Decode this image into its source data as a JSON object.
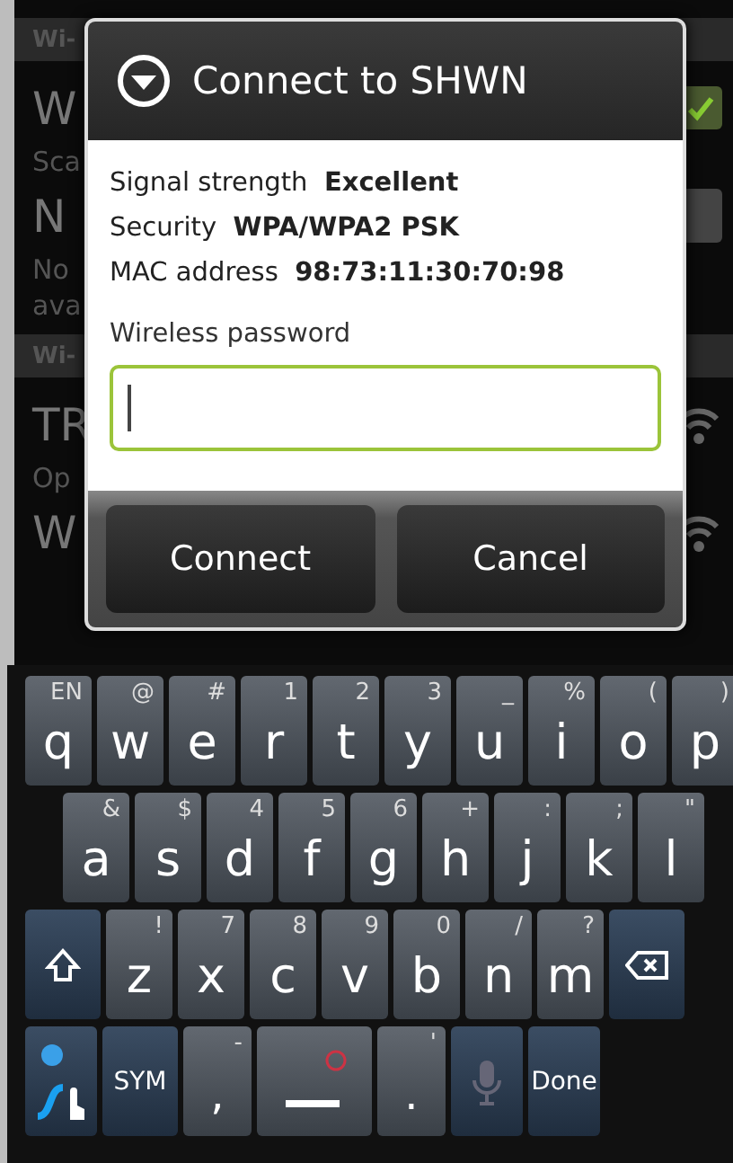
{
  "background": {
    "rows": [
      {
        "kind": "header",
        "text": "Wi-"
      },
      {
        "kind": "title",
        "text": "W",
        "checkbox": {
          "checked": true
        }
      },
      {
        "kind": "subtitle",
        "text": "Sca"
      },
      {
        "kind": "title",
        "text": "N",
        "toggle": true
      },
      {
        "kind": "subtitle",
        "text": "No"
      },
      {
        "kind": "subtitle",
        "text": "ava"
      },
      {
        "kind": "header",
        "text": "Wi-"
      },
      {
        "kind": "title",
        "text": "TR",
        "wifi": true
      },
      {
        "kind": "subtitle",
        "text": "Op"
      },
      {
        "kind": "title",
        "text": "W",
        "wifi": true
      }
    ]
  },
  "dialog": {
    "title": "Connect to SHWN",
    "details": [
      {
        "label": "Signal strength",
        "value": "Excellent"
      },
      {
        "label": "Security",
        "value": "WPA/WPA2 PSK"
      },
      {
        "label": "MAC address",
        "value": "98:73:11:30:70:98"
      }
    ],
    "password": {
      "label": "Wireless password",
      "focused": true
    },
    "buttons": [
      "Connect",
      "Cancel"
    ]
  },
  "keyboard": {
    "letter_rows": [
      [
        {
          "kind": "char",
          "hint": "EN",
          "main": "q"
        },
        {
          "kind": "char",
          "hint": "@",
          "main": "w"
        },
        {
          "kind": "char",
          "hint": "#",
          "main": "e"
        },
        {
          "kind": "char",
          "hint": "1",
          "main": "r"
        },
        {
          "kind": "char",
          "hint": "2",
          "main": "t"
        },
        {
          "kind": "char",
          "hint": "3",
          "main": "y"
        },
        {
          "kind": "char",
          "hint": "_",
          "main": "u"
        },
        {
          "kind": "char",
          "hint": "%",
          "main": "i"
        },
        {
          "kind": "char",
          "hint": "(",
          "main": "o"
        },
        {
          "kind": "char",
          "hint": ")",
          "main": "p"
        }
      ],
      [
        {
          "kind": "char",
          "hint": "&",
          "main": "a"
        },
        {
          "kind": "char",
          "hint": "$",
          "main": "s"
        },
        {
          "kind": "char",
          "hint": "4",
          "main": "d"
        },
        {
          "kind": "char",
          "hint": "5",
          "main": "f"
        },
        {
          "kind": "char",
          "hint": "6",
          "main": "g"
        },
        {
          "kind": "char",
          "hint": "+",
          "main": "h"
        },
        {
          "kind": "char",
          "hint": ":",
          "main": "j"
        },
        {
          "kind": "char",
          "hint": ";",
          "main": "k"
        },
        {
          "kind": "char",
          "hint": "\"",
          "main": "l"
        }
      ],
      [
        {
          "kind": "shift"
        },
        {
          "kind": "char",
          "hint": "!",
          "main": "z"
        },
        {
          "kind": "char",
          "hint": "7",
          "main": "x"
        },
        {
          "kind": "char",
          "hint": "8",
          "main": "c"
        },
        {
          "kind": "char",
          "hint": "9",
          "main": "v"
        },
        {
          "kind": "char",
          "hint": "0",
          "main": "b"
        },
        {
          "kind": "char",
          "hint": "/",
          "main": "n"
        },
        {
          "kind": "char",
          "hint": "?",
          "main": "m"
        },
        {
          "kind": "backspace"
        }
      ]
    ],
    "bottom_row": [
      {
        "kind": "swype"
      },
      {
        "kind": "label",
        "main": "SYM"
      },
      {
        "kind": "char",
        "hint": "-",
        "main": ","
      },
      {
        "kind": "space"
      },
      {
        "kind": "char",
        "hint": "'",
        "main": "."
      },
      {
        "kind": "mic"
      },
      {
        "kind": "label",
        "main": "Done"
      }
    ]
  }
}
